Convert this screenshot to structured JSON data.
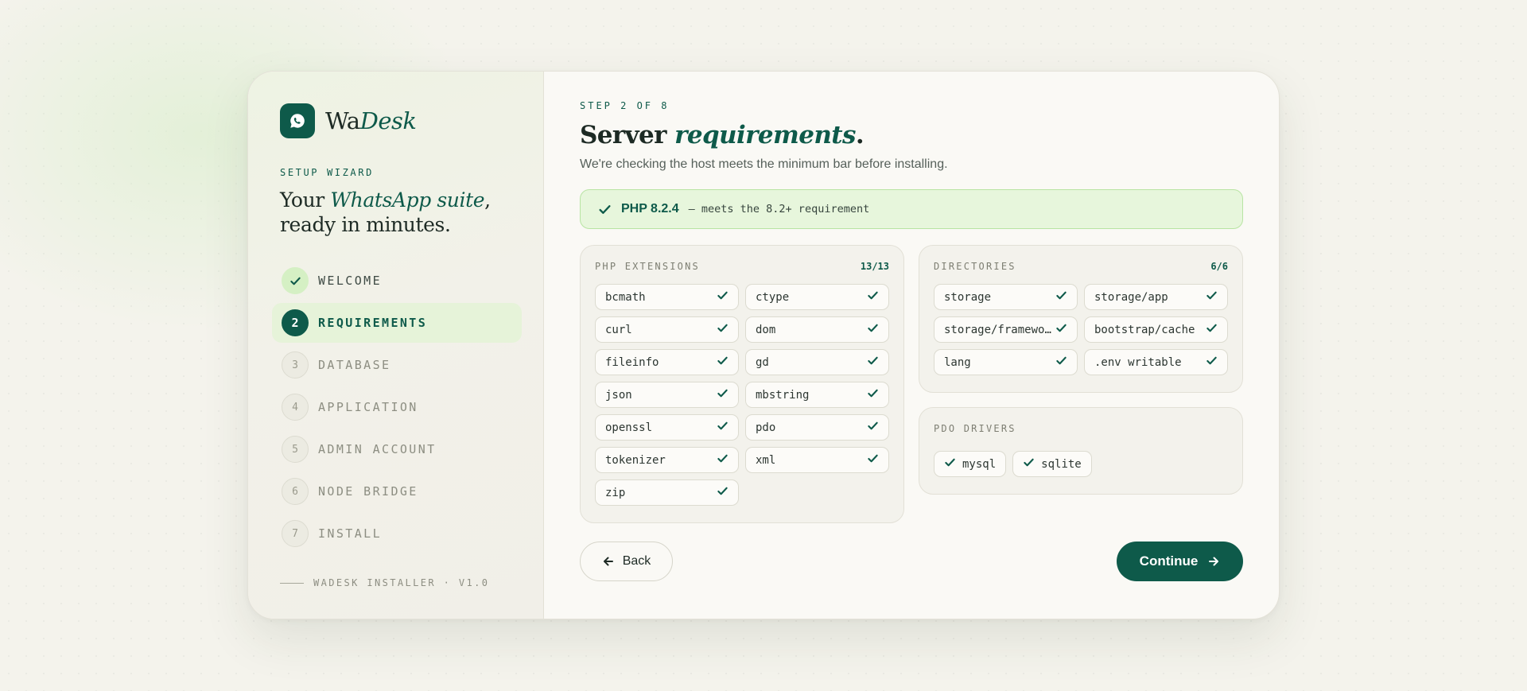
{
  "brand": {
    "name_plain": "Wa",
    "name_italic": "Desk"
  },
  "sidebar": {
    "eyebrow": "SETUP WIZARD",
    "tagline": {
      "pre": "Your ",
      "em": "WhatsApp suite",
      "post": ",",
      "line2": "ready in minutes."
    },
    "steps": [
      {
        "num": "",
        "label": "WELCOME",
        "state": "done"
      },
      {
        "num": "2",
        "label": "REQUIREMENTS",
        "state": "active"
      },
      {
        "num": "3",
        "label": "DATABASE",
        "state": "pending"
      },
      {
        "num": "4",
        "label": "APPLICATION",
        "state": "pending"
      },
      {
        "num": "5",
        "label": "ADMIN ACCOUNT",
        "state": "pending"
      },
      {
        "num": "6",
        "label": "NODE BRIDGE",
        "state": "pending"
      },
      {
        "num": "7",
        "label": "INSTALL",
        "state": "pending"
      }
    ],
    "footer": "WADESK INSTALLER · V1.0"
  },
  "main": {
    "step_count": "STEP 2 OF 8",
    "title": {
      "pre": "Server ",
      "em": "requirements",
      "post": "."
    },
    "subtitle": "We're checking the host meets the minimum bar before installing.",
    "php_banner": {
      "version": "PHP 8.2.4",
      "note": "— meets the 8.2+ requirement"
    },
    "extensions": {
      "title": "PHP EXTENSIONS",
      "count": "13/13",
      "items": [
        "bcmath",
        "ctype",
        "curl",
        "dom",
        "fileinfo",
        "gd",
        "json",
        "mbstring",
        "openssl",
        "pdo",
        "tokenizer",
        "xml",
        "zip"
      ]
    },
    "directories": {
      "title": "DIRECTORIES",
      "count": "6/6",
      "items": [
        "storage",
        "storage/app",
        "storage/framework",
        "bootstrap/cache",
        "lang",
        ".env writable"
      ]
    },
    "pdo": {
      "title": "PDO DRIVERS",
      "items": [
        "mysql",
        "sqlite"
      ]
    },
    "back_label": "Back",
    "continue_label": "Continue"
  },
  "colors": {
    "accent": "#0e5a4a",
    "success_bg": "#e7f6dc",
    "success_border": "#b8e4a3",
    "check_bg": "#d5f0c4"
  },
  "icons": {
    "logo": "whatsapp-icon",
    "check": "check-icon",
    "back": "arrow-left-icon",
    "continue": "arrow-right-icon"
  }
}
